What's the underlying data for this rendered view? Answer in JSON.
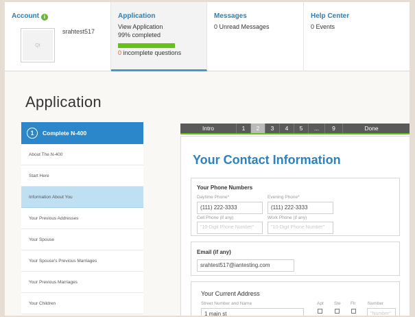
{
  "account": {
    "title": "Account",
    "info_icon": "i",
    "username": "srahtest517",
    "avatar_placeholder": "Qt"
  },
  "application": {
    "title": "Application",
    "view_link": "View Application",
    "completed": "99% completed",
    "progress_fraction": 0.99,
    "incomplete_count": "0",
    "incomplete_text": " incomplete questions"
  },
  "messages": {
    "title": "Messages",
    "text": "0 Unread Messages"
  },
  "help_center": {
    "title": "Help Center",
    "text": "0 Events"
  },
  "page": {
    "title": "Application"
  },
  "sidebar": {
    "header_step": "1",
    "header_label": "Complete N-400",
    "items": [
      {
        "label": "About The N-400"
      },
      {
        "label": "Start Here"
      },
      {
        "label": "Information About You"
      },
      {
        "label": "Your Previous Addresses"
      },
      {
        "label": "Your Spouse"
      },
      {
        "label": "Your Spouse's Previous Marriages"
      },
      {
        "label": "Your Previous Marriages"
      },
      {
        "label": "Your Children"
      }
    ],
    "current_index": 2
  },
  "stepper": {
    "steps": [
      "Intro",
      "1",
      "2",
      "3",
      "4",
      "5",
      "...",
      "9",
      "Done"
    ],
    "active": "2"
  },
  "form": {
    "heading": "Your Contact Information",
    "phone_section": {
      "title": "Your Phone Numbers",
      "daytime_label": "Daytime Phone*",
      "daytime_value": "(111) 222-3333",
      "evening_label": "Evening Phone*",
      "evening_value": "(111) 222-3333",
      "cell_label": "Cell Phone (if any)",
      "cell_placeholder": "\"10-Digit Phone Number\"",
      "work_label": "Work Phone (if any)",
      "work_placeholder": "\"10-Digit Phone Number\""
    },
    "email_section": {
      "title": "Email (if any)",
      "value": "srahtest517@iantesting.com"
    },
    "address_section": {
      "title": "Your Current Address",
      "street_label": "Street Number and Name",
      "street_value": "1 main st",
      "apt_label": "Apt",
      "ste_label": "Ste",
      "flr_label": "Flr",
      "number_label": "Number",
      "number_placeholder": "\"Number\""
    }
  },
  "colors": {
    "link_blue": "#2a7fb5",
    "accent_blue": "#2b87c9",
    "progress_green": "#66c21a",
    "selected_item": "#bfe0f3",
    "stepper_bg": "#5a5a5a"
  }
}
